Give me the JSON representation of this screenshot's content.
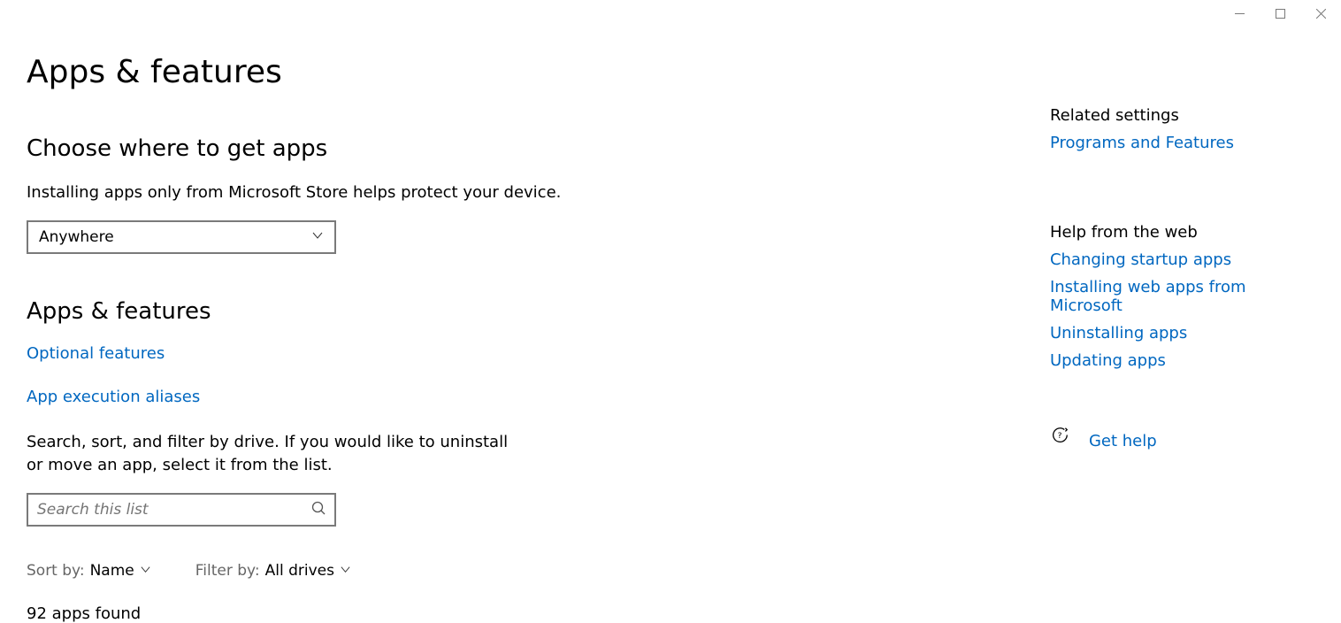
{
  "title": "Apps & features",
  "section_choose": {
    "heading": "Choose where to get apps",
    "desc": "Installing apps only from Microsoft Store helps protect your device.",
    "dropdown_value": "Anywhere"
  },
  "section_apps": {
    "heading": "Apps & features",
    "link_optional": "Optional features",
    "link_aliases": "App execution aliases",
    "instruct": "Search, sort, and filter by drive. If you would like to uninstall or move an app, select it from the list.",
    "search_placeholder": "Search this list",
    "sort_label": "Sort by:",
    "sort_value": "Name",
    "filter_label": "Filter by:",
    "filter_value": "All drives",
    "count": "92 apps found"
  },
  "side": {
    "related_heading": "Related settings",
    "related_link": "Programs and Features",
    "help_heading": "Help from the web",
    "help_links": [
      "Changing startup apps",
      "Installing web apps from Microsoft",
      "Uninstalling apps",
      "Updating apps"
    ],
    "get_help": "Get help"
  }
}
